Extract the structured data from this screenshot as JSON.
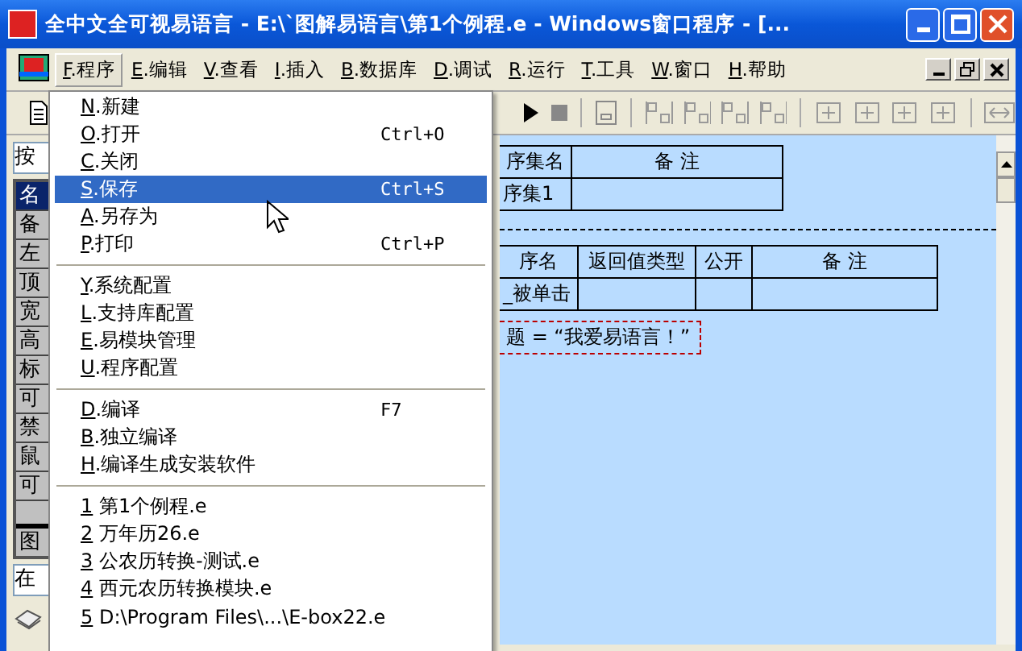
{
  "window": {
    "title": "全中文全可视易语言 - E:\\`图解易语言\\第1个例程.e - Windows窗口程序 - [..."
  },
  "menubar": {
    "items": [
      {
        "label": "F.程序",
        "selected": true
      },
      {
        "label": "E.编辑",
        "selected": false
      },
      {
        "label": "V.查看",
        "selected": false
      },
      {
        "label": "I.插入",
        "selected": false
      },
      {
        "label": "B.数据库",
        "selected": false
      },
      {
        "label": "D.调试",
        "selected": false
      },
      {
        "label": "R.运行",
        "selected": false
      },
      {
        "label": "T.工具",
        "selected": false
      },
      {
        "label": "W.窗口",
        "selected": false
      },
      {
        "label": "H.帮助",
        "selected": false
      }
    ]
  },
  "properties_panel": {
    "type_field": "按",
    "rows": [
      {
        "label": "名",
        "selected": true
      },
      {
        "label": "备",
        "selected": false
      },
      {
        "label": "左",
        "selected": false
      },
      {
        "label": "顶",
        "selected": false
      },
      {
        "label": "宽",
        "selected": false
      },
      {
        "label": "高",
        "selected": false
      },
      {
        "label": "标",
        "selected": false
      },
      {
        "label": "可",
        "selected": false
      },
      {
        "label": "禁",
        "selected": false
      },
      {
        "label": "鼠",
        "selected": false
      },
      {
        "label": "可",
        "selected": false
      }
    ],
    "tab": "图",
    "event_field": "在"
  },
  "program_menu": {
    "items": [
      {
        "kind": "item",
        "label": "N.新建",
        "selected": false
      },
      {
        "kind": "item",
        "label": "O.打开",
        "shortcut": "Ctrl+O",
        "selected": false
      },
      {
        "kind": "item",
        "label": "C.关闭",
        "selected": false
      },
      {
        "kind": "item",
        "label": "S.保存",
        "shortcut": "Ctrl+S",
        "selected": true
      },
      {
        "kind": "item",
        "label": "A.另存为",
        "selected": false
      },
      {
        "kind": "item",
        "label": "P.打印",
        "shortcut": "Ctrl+P",
        "selected": false
      },
      {
        "kind": "separator"
      },
      {
        "kind": "item",
        "label": "Y.系统配置",
        "selected": false
      },
      {
        "kind": "item",
        "label": "L.支持库配置",
        "selected": false
      },
      {
        "kind": "item",
        "label": "E.易模块管理",
        "selected": false
      },
      {
        "kind": "item",
        "label": "U.程序配置",
        "selected": false
      },
      {
        "kind": "separator"
      },
      {
        "kind": "item",
        "label": "D.编译",
        "shortcut": "F7",
        "selected": false
      },
      {
        "kind": "item",
        "label": "B.独立编译",
        "selected": false
      },
      {
        "kind": "item",
        "label": "H.编译生成安装软件",
        "selected": false
      },
      {
        "kind": "separator"
      },
      {
        "kind": "item",
        "label": "1 第1个例程.e",
        "selected": false
      },
      {
        "kind": "item",
        "label": "2 万年历26.e",
        "selected": false
      },
      {
        "kind": "item",
        "label": "3 公农历转换-测试.e",
        "selected": false
      },
      {
        "kind": "item",
        "label": "4 西元农历转换模块.e",
        "selected": false
      },
      {
        "kind": "item",
        "label": "5 D:\\Program Files\\...\\E-box22.e",
        "selected": false
      }
    ]
  },
  "editor": {
    "table_1": {
      "columns": [
        "序集名",
        "备 注"
      ],
      "rows": [
        {
          "cells": [
            "序集1"
          ]
        }
      ]
    },
    "table_2": {
      "columns": [
        "序名",
        "返回值类型",
        "公开",
        "备 注"
      ],
      "rows": [
        {
          "cells": [
            "_被单击"
          ]
        }
      ]
    },
    "code_line": "题 = “我爱易语言！”"
  }
}
